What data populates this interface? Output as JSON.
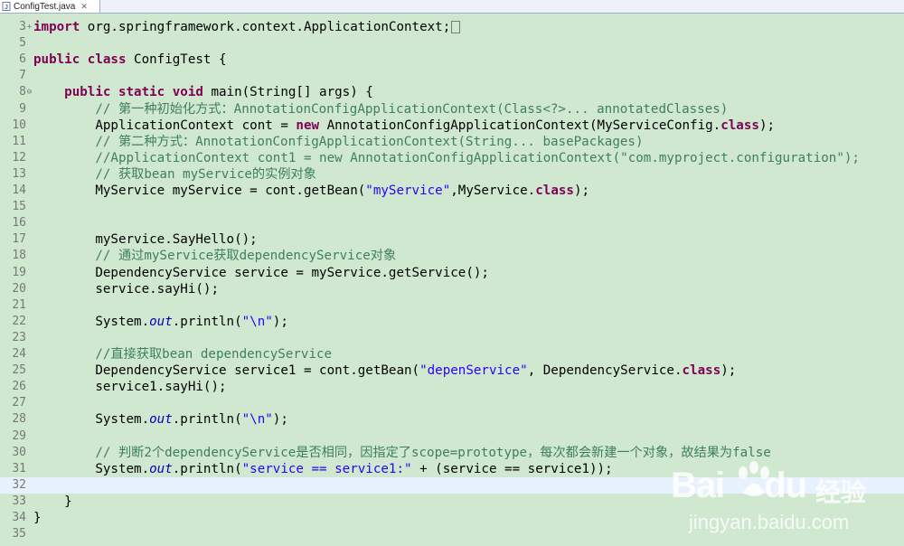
{
  "tab": {
    "filename": "ConfigTest.java",
    "close_glyph": "✕",
    "icon": "java-file-icon"
  },
  "colors": {
    "background": "#cfe8cf",
    "keyword": "#7f0055",
    "comment": "#3f7f5f",
    "string": "#2a00ff",
    "field": "#0000c0",
    "current_line": "#e8f2fe"
  },
  "lines": [
    {
      "num": "3",
      "marker": "+",
      "current": false,
      "tokens": [
        {
          "t": "kw",
          "v": "import"
        },
        {
          "t": "pl",
          "v": " org.springframework.context.ApplicationContext;"
        },
        {
          "t": "box",
          "v": ""
        }
      ]
    },
    {
      "num": "5",
      "marker": "",
      "current": false,
      "tokens": []
    },
    {
      "num": "6",
      "marker": "",
      "current": false,
      "tokens": [
        {
          "t": "kw",
          "v": "public"
        },
        {
          "t": "pl",
          "v": " "
        },
        {
          "t": "kw",
          "v": "class"
        },
        {
          "t": "pl",
          "v": " ConfigTest {"
        }
      ]
    },
    {
      "num": "7",
      "marker": "",
      "current": false,
      "tokens": []
    },
    {
      "num": "8",
      "marker": "⊖",
      "current": false,
      "tokens": [
        {
          "t": "pl",
          "v": "    "
        },
        {
          "t": "kw",
          "v": "public"
        },
        {
          "t": "pl",
          "v": " "
        },
        {
          "t": "kw",
          "v": "static"
        },
        {
          "t": "pl",
          "v": " "
        },
        {
          "t": "kw",
          "v": "void"
        },
        {
          "t": "pl",
          "v": " main(String[] args) {"
        }
      ]
    },
    {
      "num": "9",
      "marker": "",
      "current": false,
      "tokens": [
        {
          "t": "pl",
          "v": "        "
        },
        {
          "t": "cm",
          "v": "// 第一种初始化方式：AnnotationConfigApplicationContext(Class<?>... annotatedClasses)"
        }
      ]
    },
    {
      "num": "10",
      "marker": "",
      "current": false,
      "tokens": [
        {
          "t": "pl",
          "v": "        ApplicationContext cont = "
        },
        {
          "t": "kw",
          "v": "new"
        },
        {
          "t": "pl",
          "v": " AnnotationConfigApplicationContext(MyServiceConfig."
        },
        {
          "t": "kw",
          "v": "class"
        },
        {
          "t": "pl",
          "v": ");"
        }
      ]
    },
    {
      "num": "11",
      "marker": "",
      "current": false,
      "tokens": [
        {
          "t": "pl",
          "v": "        "
        },
        {
          "t": "cm",
          "v": "// 第二种方式：AnnotationConfigApplicationContext(String... basePackages)"
        }
      ]
    },
    {
      "num": "12",
      "marker": "",
      "current": false,
      "tokens": [
        {
          "t": "pl",
          "v": "        "
        },
        {
          "t": "cm",
          "v": "//ApplicationContext cont1 = new AnnotationConfigApplicationContext(\"com.myproject.configuration\");"
        }
      ]
    },
    {
      "num": "13",
      "marker": "",
      "current": false,
      "tokens": [
        {
          "t": "pl",
          "v": "        "
        },
        {
          "t": "cm",
          "v": "// 获取bean myService的实例对象"
        }
      ]
    },
    {
      "num": "14",
      "marker": "",
      "current": false,
      "tokens": [
        {
          "t": "pl",
          "v": "        MyService myService = cont.getBean("
        },
        {
          "t": "st",
          "v": "\"myService\""
        },
        {
          "t": "pl",
          "v": ",MyService."
        },
        {
          "t": "kw",
          "v": "class"
        },
        {
          "t": "pl",
          "v": ");"
        }
      ]
    },
    {
      "num": "15",
      "marker": "",
      "current": false,
      "tokens": []
    },
    {
      "num": "16",
      "marker": "",
      "current": false,
      "tokens": []
    },
    {
      "num": "17",
      "marker": "",
      "current": false,
      "tokens": [
        {
          "t": "pl",
          "v": "        myService.SayHello();"
        }
      ]
    },
    {
      "num": "18",
      "marker": "",
      "current": false,
      "tokens": [
        {
          "t": "pl",
          "v": "        "
        },
        {
          "t": "cm",
          "v": "// 通过myService获取dependencyService对象"
        }
      ]
    },
    {
      "num": "19",
      "marker": "",
      "current": false,
      "tokens": [
        {
          "t": "pl",
          "v": "        DependencyService service = myService.getService();"
        }
      ]
    },
    {
      "num": "20",
      "marker": "",
      "current": false,
      "tokens": [
        {
          "t": "pl",
          "v": "        service.sayHi();"
        }
      ]
    },
    {
      "num": "21",
      "marker": "",
      "current": false,
      "tokens": []
    },
    {
      "num": "22",
      "marker": "",
      "current": false,
      "tokens": [
        {
          "t": "pl",
          "v": "        System."
        },
        {
          "t": "fld",
          "v": "out"
        },
        {
          "t": "pl",
          "v": ".println("
        },
        {
          "t": "st",
          "v": "\"\\n\""
        },
        {
          "t": "pl",
          "v": ");"
        }
      ]
    },
    {
      "num": "23",
      "marker": "",
      "current": false,
      "tokens": []
    },
    {
      "num": "24",
      "marker": "",
      "current": false,
      "tokens": [
        {
          "t": "pl",
          "v": "        "
        },
        {
          "t": "cm",
          "v": "//直接获取bean dependencyService"
        }
      ]
    },
    {
      "num": "25",
      "marker": "",
      "current": false,
      "tokens": [
        {
          "t": "pl",
          "v": "        DependencyService service1 = cont.getBean("
        },
        {
          "t": "st",
          "v": "\"depenService\""
        },
        {
          "t": "pl",
          "v": ", DependencyService."
        },
        {
          "t": "kw",
          "v": "class"
        },
        {
          "t": "pl",
          "v": ");"
        }
      ]
    },
    {
      "num": "26",
      "marker": "",
      "current": false,
      "tokens": [
        {
          "t": "pl",
          "v": "        service1.sayHi();"
        }
      ]
    },
    {
      "num": "27",
      "marker": "",
      "current": false,
      "tokens": []
    },
    {
      "num": "28",
      "marker": "",
      "current": false,
      "tokens": [
        {
          "t": "pl",
          "v": "        System."
        },
        {
          "t": "fld",
          "v": "out"
        },
        {
          "t": "pl",
          "v": ".println("
        },
        {
          "t": "st",
          "v": "\"\\n\""
        },
        {
          "t": "pl",
          "v": ");"
        }
      ]
    },
    {
      "num": "29",
      "marker": "",
      "current": false,
      "tokens": []
    },
    {
      "num": "30",
      "marker": "",
      "current": false,
      "tokens": [
        {
          "t": "pl",
          "v": "        "
        },
        {
          "t": "cm",
          "v": "// 判断2个dependencyService是否相同，因指定了scope=prototype，每次都会新建一个对象，故结果为false"
        }
      ]
    },
    {
      "num": "31",
      "marker": "",
      "current": false,
      "tokens": [
        {
          "t": "pl",
          "v": "        System."
        },
        {
          "t": "fld",
          "v": "out"
        },
        {
          "t": "pl",
          "v": ".println("
        },
        {
          "t": "st",
          "v": "\"service == service1:\""
        },
        {
          "t": "pl",
          "v": " + (service == service1));"
        }
      ]
    },
    {
      "num": "32",
      "marker": "",
      "current": true,
      "tokens": []
    },
    {
      "num": "33",
      "marker": "",
      "current": false,
      "tokens": [
        {
          "t": "pl",
          "v": "    }"
        }
      ]
    },
    {
      "num": "34",
      "marker": "",
      "current": false,
      "tokens": [
        {
          "t": "pl",
          "v": "}"
        }
      ]
    },
    {
      "num": "35",
      "marker": "",
      "current": false,
      "tokens": []
    }
  ],
  "watermark": {
    "logo_text": "Bai",
    "logo_text2": "du",
    "brand_cn": "经验",
    "url": "jingyan.baidu.com"
  }
}
